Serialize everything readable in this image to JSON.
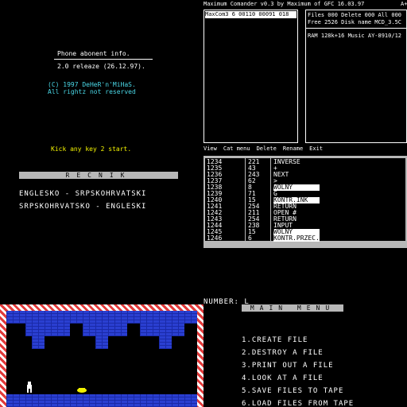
{
  "phone_info": {
    "title": "Phone abonent info.",
    "release": "2.0 releaze (26.12.97).",
    "copyright": "(C) 1997 DeHeR'n'MiHaS.",
    "rights": "All rightz not reserved",
    "prompt": "Kick any key 2 start."
  },
  "maxcom": {
    "header": "Maximum Comander v0.3 by Maximum of GFC 16.03.97",
    "header_right": "A+",
    "left_panel_line": "MaxCom3  6   00110 00091 018",
    "info_line1": "Files 000 Delete 000 All 000",
    "info_line2": "Free 2526 Disk name MCD_3.5C",
    "info_line3": "RAM 128k+16 Music AY-8910/12",
    "menu": [
      "View",
      "Cat menu",
      "Delete",
      "Rename",
      "Exit"
    ]
  },
  "recnik": {
    "title": "RECNIK",
    "items": [
      "ENGLESKO - SRPSKOHRVATSKI",
      "SRPSKOHRVATSKO - ENGLESKI"
    ]
  },
  "listing": {
    "rows": [
      {
        "addr": "1234",
        "code": "221",
        "token": "INVERSE"
      },
      {
        "addr": "1235",
        "code": "43",
        "token": "+"
      },
      {
        "addr": "1236",
        "code": "243",
        "token": "NEXT"
      },
      {
        "addr": "1237",
        "code": "62",
        "token": ">"
      },
      {
        "addr": "1238",
        "code": "8",
        "token": "WOLNY"
      },
      {
        "addr": "1239",
        "code": "71",
        "token": "G"
      },
      {
        "addr": "1240",
        "code": "15",
        "token": "KONTR.INK"
      },
      {
        "addr": "1241",
        "code": "254",
        "token": "RETURN"
      },
      {
        "addr": "1242",
        "code": "211",
        "token": "OPEN #"
      },
      {
        "addr": "1243",
        "code": "254",
        "token": "RETURN"
      },
      {
        "addr": "1244",
        "code": "238",
        "token": "INPUT"
      },
      {
        "addr": "1245",
        "code": "15",
        "token": "WOLNY"
      },
      {
        "addr": "1246",
        "code": "6",
        "token": "KONTR.PRZEC."
      }
    ]
  },
  "main_menu": {
    "number_label": "NUMBER: L",
    "title": "MAIN MENU",
    "items": [
      "1.CREATE FILE",
      "2.DESTROY A FILE",
      "3.PRINT OUT A FILE",
      "4.LOOK AT A FILE",
      "5.SAVE FILES TO TAPE",
      "6.LOAD FILES FROM TAPE"
    ]
  },
  "colors": {
    "background": "#000000",
    "cyan_text": "#4ad7e6",
    "yellow_text": "#f2f200",
    "gray_bar": "#b8b8b8",
    "brick_blue": "#2a3fd1",
    "frame_red": "#e23a3a"
  }
}
